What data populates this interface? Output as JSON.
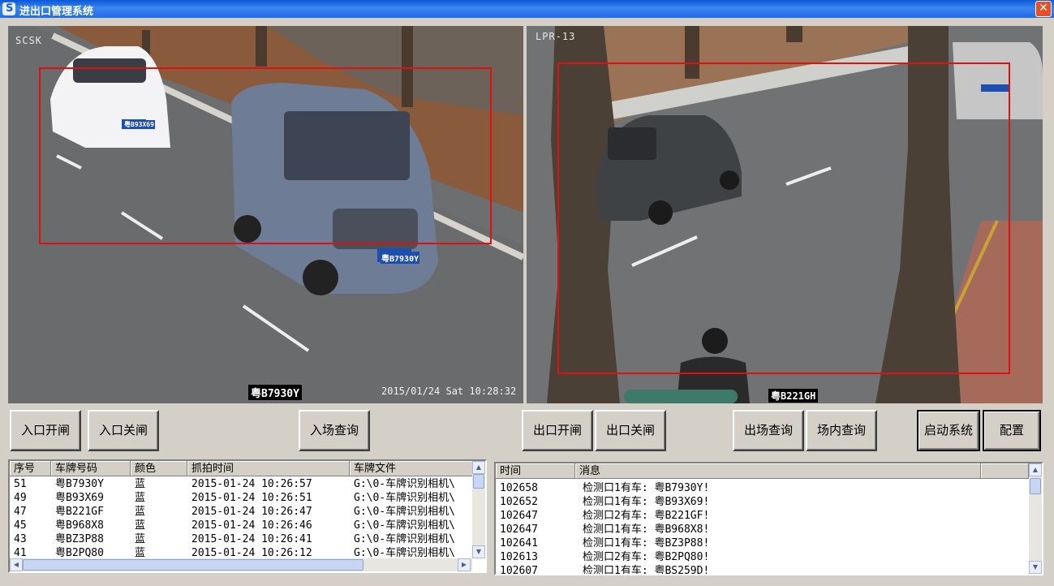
{
  "window": {
    "title": "进出口管理系统",
    "icon_letter": "S",
    "close_glyph": "✕"
  },
  "cameras": {
    "left": {
      "label": "SCSK",
      "plate_tag": "粤B7930Y",
      "timestamp": "2015/01/24 Sat 10:28:32",
      "van_plate": "粤B7930Y",
      "car_plate": "粤B93X69"
    },
    "right": {
      "label": "LPR-13",
      "plate_tag": "粤B221GH",
      "van_plate": "粤B221GH"
    }
  },
  "buttons": {
    "entry_open": "入口开闸",
    "entry_close": "入口关闸",
    "entry_query": "入场查询",
    "exit_open": "出口开闸",
    "exit_close": "出口关闸",
    "exit_query": "出场查询",
    "inside_query": "场内查询",
    "start_system": "启动系统",
    "config": "配置"
  },
  "capture_list": {
    "columns": [
      "序号",
      "车牌号码",
      "颜色",
      "抓拍时间",
      "车牌文件"
    ],
    "rows": [
      [
        "51",
        "粤B7930Y",
        "蓝",
        "2015-01-24 10:26:57",
        "G:\\0-车牌识别相机\\"
      ],
      [
        "49",
        "粤B93X69",
        "蓝",
        "2015-01-24 10:26:51",
        "G:\\0-车牌识别相机\\"
      ],
      [
        "47",
        "粤B221GF",
        "蓝",
        "2015-01-24 10:26:47",
        "G:\\0-车牌识别相机\\"
      ],
      [
        "45",
        "粤B968X8",
        "蓝",
        "2015-01-24 10:26:46",
        "G:\\0-车牌识别相机\\"
      ],
      [
        "43",
        "粤BZ3P88",
        "蓝",
        "2015-01-24 10:26:41",
        "G:\\0-车牌识别相机\\"
      ],
      [
        "41",
        "粤B2PQ80",
        "蓝",
        "2015-01-24 10:26:12",
        "G:\\0-车牌识别相机\\"
      ]
    ]
  },
  "message_list": {
    "columns": [
      "时间",
      "消息",
      ""
    ],
    "rows": [
      [
        "102658",
        "检测口1有车: 粤B7930Y!"
      ],
      [
        "102652",
        "检测口1有车: 粤B93X69!"
      ],
      [
        "102647",
        "检测口2有车: 粤B221GF!"
      ],
      [
        "102647",
        "检测口1有车: 粤B968X8!"
      ],
      [
        "102641",
        "检测口1有车: 粤BZ3P88!"
      ],
      [
        "102613",
        "检测口2有车: 粤B2PQ80!"
      ],
      [
        "102607",
        "检测口1有车: 粤BS259D!"
      ]
    ]
  },
  "scroll_glyphs": {
    "up": "▲",
    "down": "▼",
    "left": "◀",
    "right": "▶"
  }
}
